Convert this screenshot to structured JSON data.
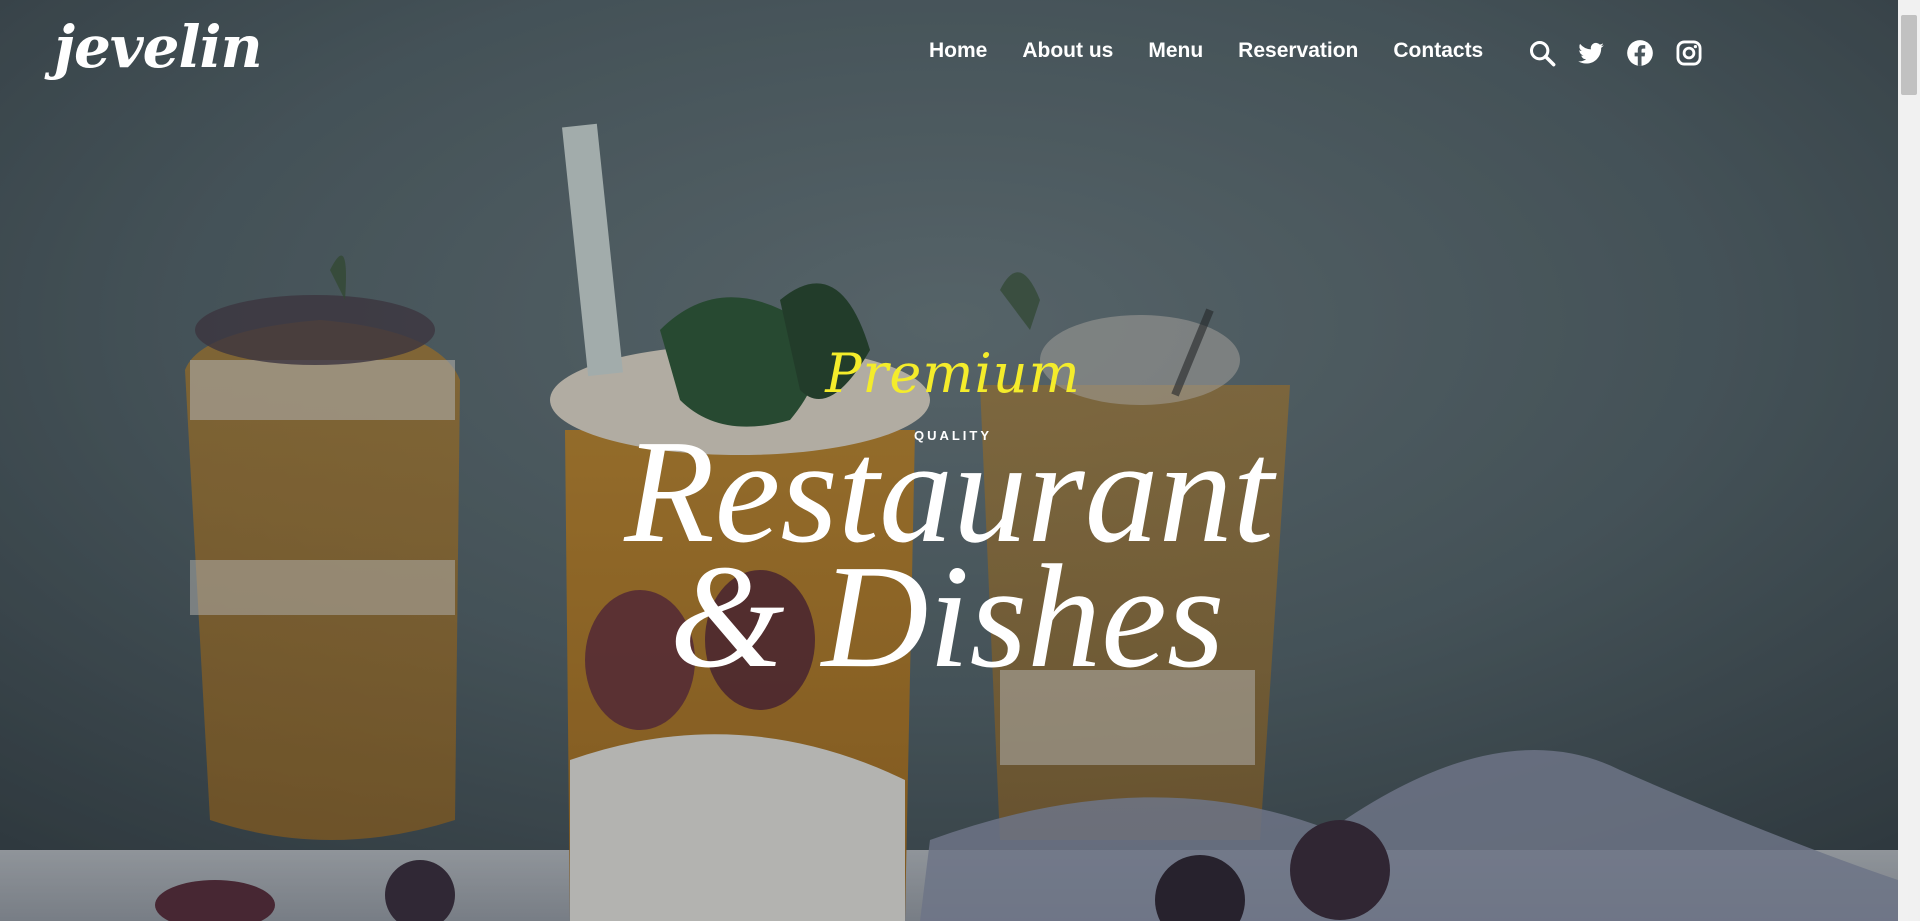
{
  "brand": {
    "logo_text": "jevelin"
  },
  "nav": {
    "items": [
      {
        "label": "Home"
      },
      {
        "label": "About us"
      },
      {
        "label": "Menu"
      },
      {
        "label": "Reservation"
      },
      {
        "label": "Contacts"
      }
    ],
    "icons": [
      "search-icon",
      "twitter-icon",
      "facebook-icon",
      "instagram-icon"
    ]
  },
  "hero": {
    "script_text": "Premium",
    "eyebrow": "QUALITY",
    "title_line_1": "Restaurant",
    "title_line_2": "& Dishes"
  },
  "colors": {
    "accent": "#f4ec2b",
    "text": "#ffffff"
  }
}
